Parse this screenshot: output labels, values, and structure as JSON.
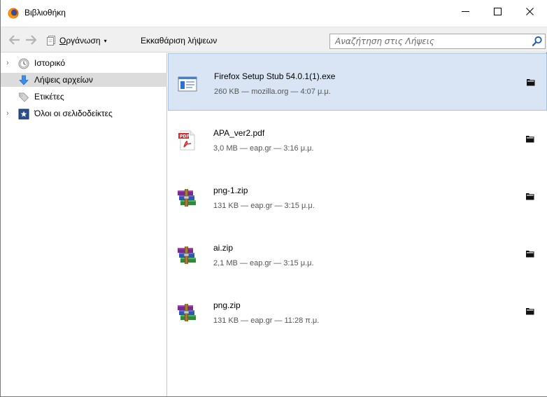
{
  "window": {
    "title": "Βιβλιοθήκη"
  },
  "toolbar": {
    "organize_prefix": "Ο",
    "organize_rest": "ργάνωση",
    "clear_downloads": "Εκκαθάριση λήψεων",
    "search_placeholder": "Αναζήτηση στις Λήψεις"
  },
  "sidebar": {
    "items": [
      {
        "label": "Ιστορικό",
        "icon": "history-clock-icon",
        "expandable": true,
        "selected": false
      },
      {
        "label": "Λήψεις αρχείων",
        "icon": "download-arrow-icon",
        "expandable": false,
        "selected": true
      },
      {
        "label": "Ετικέτες",
        "icon": "tag-icon",
        "expandable": false,
        "selected": false
      },
      {
        "label": "Όλοι οι σελιδοδείκτες",
        "icon": "bookmarks-star-icon",
        "expandable": true,
        "selected": false
      }
    ]
  },
  "downloads": [
    {
      "name": "Firefox Setup Stub 54.0.1(1).exe",
      "meta": "260 KB — mozilla.org — 4:07 μ.μ.",
      "icon": "exe-file-icon",
      "selected": true
    },
    {
      "name": "APA_ver2.pdf",
      "meta": "3,0 MB — eap.gr — 3:16 μ.μ.",
      "icon": "pdf-file-icon",
      "selected": false
    },
    {
      "name": "png-1.zip",
      "meta": "131 KB — eap.gr — 3:15 μ.μ.",
      "icon": "zip-archive-icon",
      "selected": false
    },
    {
      "name": "ai.zip",
      "meta": "2,1 MB — eap.gr — 3:15 μ.μ.",
      "icon": "zip-archive-icon",
      "selected": false
    },
    {
      "name": "png.zip",
      "meta": "131 KB — eap.gr — 11:28 π.μ.",
      "icon": "zip-archive-icon",
      "selected": false
    }
  ],
  "colors": {
    "selection_bg": "#d9e5f5",
    "selection_border": "#a8c3e6",
    "sidebar_selected_bg": "#dcdcdc",
    "toolbar_bg": "#f0f0f0"
  }
}
